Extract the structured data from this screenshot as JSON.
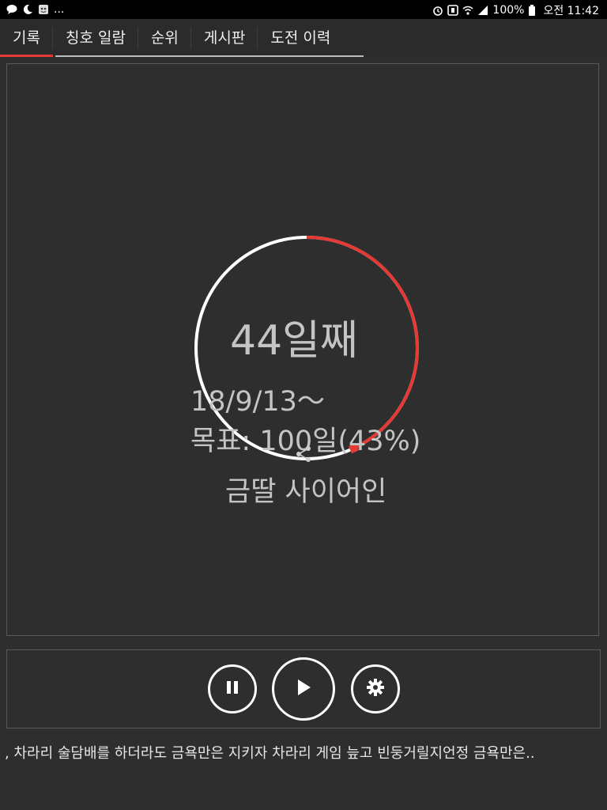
{
  "status_bar": {
    "battery": "100%",
    "time": "오전 11:42",
    "left_icons": [
      "chat-icon",
      "moon-icon",
      "app-icon",
      "more-notifications-icon"
    ],
    "right_icons": [
      "alarm-icon",
      "nfc-icon",
      "wifi-icon",
      "signal-icon",
      "battery-icon"
    ],
    "ellipsis": "..."
  },
  "tabs": [
    {
      "label": "기록",
      "active": true
    },
    {
      "label": "칭호 일람",
      "active": false
    },
    {
      "label": "순위",
      "active": false
    },
    {
      "label": "게시판",
      "active": false
    },
    {
      "label": "도전 이력",
      "active": false
    }
  ],
  "record": {
    "day_count": "44일째",
    "start_date": "18/9/13～",
    "goal": "목표: 100일(43%)",
    "progress_fraction": 0.43,
    "nickname": "금딸 사이어인",
    "progress_color": "#e53935",
    "ring_color": "#ffffff"
  },
  "controls": {
    "pause": "pause-icon",
    "play": "play-icon",
    "settings": "gear-icon"
  },
  "ticker_text": ", 차라리 술담배를 하더라도 금욕만은 지키자  차라리 게임 늪고 빈둥거릴지언정 금욕만은.."
}
